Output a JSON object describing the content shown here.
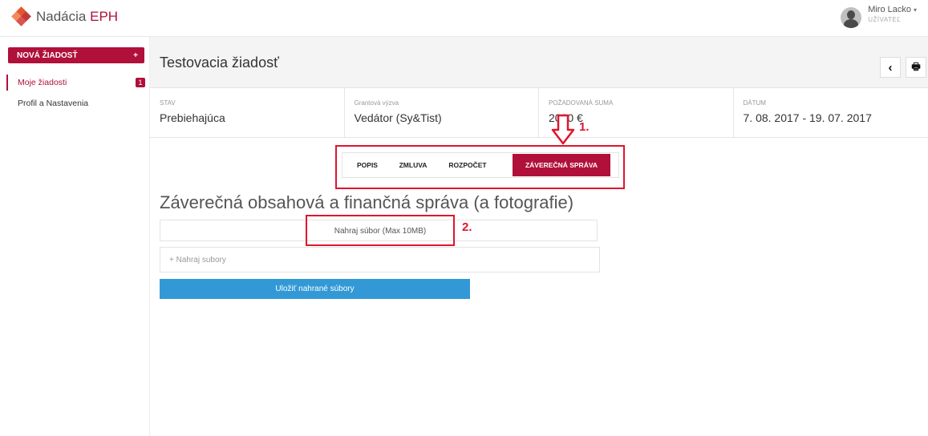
{
  "brand": {
    "name_prefix": "Nadácia ",
    "name_accent": "EPH"
  },
  "user": {
    "name": "Miro Lacko",
    "role": "UŽÍVATEĽ",
    "caret": "▾"
  },
  "sidebar": {
    "new_button": {
      "label": "NOVÁ ŽIADOSŤ",
      "icon": "+"
    },
    "items": [
      {
        "label": "Moje žiadosti",
        "badge": "1",
        "active": true
      },
      {
        "label": "Profil a Nastavenia",
        "active": false
      }
    ]
  },
  "header": {
    "title": "Testovacia žiadosť",
    "back_icon": "‹",
    "print_icon": "🖶"
  },
  "info": [
    {
      "label": "STAV",
      "value": "Prebiehajúca"
    },
    {
      "label": "Grantová výzva",
      "value": "Vedátor (Sy&Tist)"
    },
    {
      "label": "POŽADOVANÁ SUMA",
      "value": "2000 €"
    },
    {
      "label": "DÁTUM",
      "value": "7. 08. 2017 - 19. 07. 2017"
    }
  ],
  "tabs": [
    {
      "label": "POPIS",
      "active": false
    },
    {
      "label": "ZMLUVA",
      "active": false
    },
    {
      "label": "ROZPOČET",
      "active": false
    },
    {
      "label": "ZÁVEREČNÁ SPRÁVA",
      "active": true
    }
  ],
  "section": {
    "title": "Záverečná obsahová a finančná správa (a fotografie)",
    "upload_label": "Nahraj súbor (Max 10MB)",
    "dropzone_label": "+ Nahraj subory",
    "save_label": "Uložiť nahrané súbory"
  },
  "annotations": {
    "step1": "1.",
    "step2": "2."
  },
  "colors": {
    "brand": "#b0103a",
    "annotation": "#e0152e",
    "primary_button": "#3399d6"
  }
}
